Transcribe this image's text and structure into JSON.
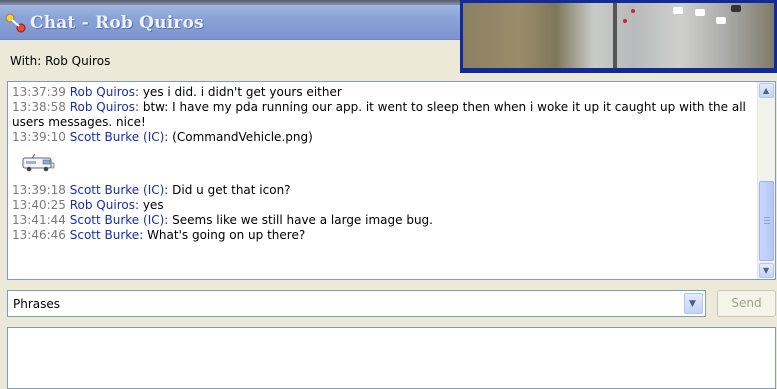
{
  "window": {
    "title": "Chat - Rob Quiros",
    "with_label": "With: Rob Quiros"
  },
  "messages": [
    {
      "time": "13:37:39",
      "sender": "Rob Quiros:",
      "text": "yes i did.  i didn't get yours either"
    },
    {
      "time": "13:38:58",
      "sender": "Rob Quiros:",
      "text": "btw:  I have my pda running our app.  it went to sleep then when i woke it up it caught up with the all users messages.  nice!"
    },
    {
      "time": "13:39:10",
      "sender": "Scott Burke (IC):",
      "text": "(CommandVehicle.png)"
    },
    {
      "time": "13:39:18",
      "sender": "Scott Burke (IC):",
      "text": "Did u get that icon?"
    },
    {
      "time": "13:40:25",
      "sender": "Rob Quiros:",
      "text": "yes"
    },
    {
      "time": "13:41:44",
      "sender": "Scott Burke (IC):",
      "text": "Seems like we still have a large image bug."
    },
    {
      "time": "13:46:46",
      "sender": "Scott Burke:",
      "text": "What's going on up there?"
    }
  ],
  "attachment_icon": "command-vehicle-icon",
  "phrases": {
    "selected": "Phrases"
  },
  "send_button": {
    "label": "Send",
    "enabled": false
  },
  "message_input": {
    "value": ""
  },
  "colors": {
    "sender": "#1a2ea8",
    "timestamp": "#7a7a7a",
    "video_border": "#102a9a",
    "background": "#ece9d8"
  }
}
